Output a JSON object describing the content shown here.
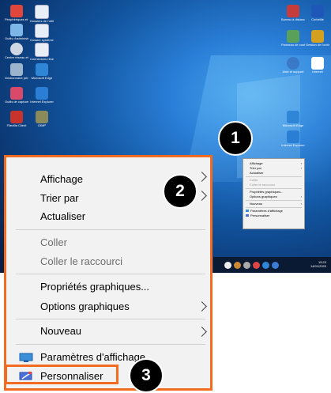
{
  "desktop": {
    "left_icons": [
      {
        "label": "Périphériques et Impri..."
      },
      {
        "label": "Dossiers de l'utilisateur"
      },
      {
        "label": "Outils d'administration"
      },
      {
        "label": "Dossier système"
      },
      {
        "label": "Centre réseau et partage"
      },
      {
        "label": "Connexions réseau"
      },
      {
        "label": "Gestionnaire périphériques"
      },
      {
        "label": "Microsoft Edge"
      },
      {
        "label": "Outils de capture"
      },
      {
        "label": "Internet Explorer"
      },
      {
        "label": "Filezilla Client"
      },
      {
        "label": "GIMP"
      }
    ],
    "right_icons": [
      {
        "label": "Bureau à distance"
      },
      {
        "label": "Corbeille"
      },
      {
        "label": "Panneau de configuration"
      },
      {
        "label": "Gestion de l'ordinateur"
      },
      {
        "label": "Aide et support"
      },
      {
        "label": "Internet"
      },
      {
        "label": "Microsoft Edge"
      },
      {
        "label": "Internet Explorer"
      }
    ],
    "mini_menu": {
      "items": [
        {
          "label": "Affichage",
          "submenu": true
        },
        {
          "label": "Trier par",
          "submenu": true
        },
        {
          "label": "Actualiser"
        },
        {
          "sep": true
        },
        {
          "label": "Coller",
          "disabled": true
        },
        {
          "label": "Coller le raccourci",
          "disabled": true
        },
        {
          "sep": true
        },
        {
          "label": "Propriétés graphiques..."
        },
        {
          "label": "Options graphiques",
          "submenu": true
        },
        {
          "sep": true
        },
        {
          "label": "Nouveau",
          "submenu": true
        },
        {
          "sep": true
        },
        {
          "label": "Paramètres d'affichage",
          "icon": "display-icon"
        },
        {
          "label": "Personnaliser",
          "icon": "personalize-icon"
        }
      ]
    },
    "taskbar": {
      "time": "15:23",
      "date": "14/01/2020"
    }
  },
  "zoomed_menu": {
    "affichage": "Affichage",
    "trier_par": "Trier par",
    "actualiser": "Actualiser",
    "coller": "Coller",
    "coller_raccourci": "Coller le raccourci",
    "proprietes": "Propriétés graphiques...",
    "options": "Options graphiques",
    "nouveau": "Nouveau",
    "parametres": "Paramètres d'affichage",
    "personnaliser": "Personnaliser"
  },
  "callouts": {
    "one": "1",
    "two": "2",
    "three": "3"
  },
  "colors": {
    "highlight": "#f36b21",
    "callout_bg": "#000000"
  }
}
